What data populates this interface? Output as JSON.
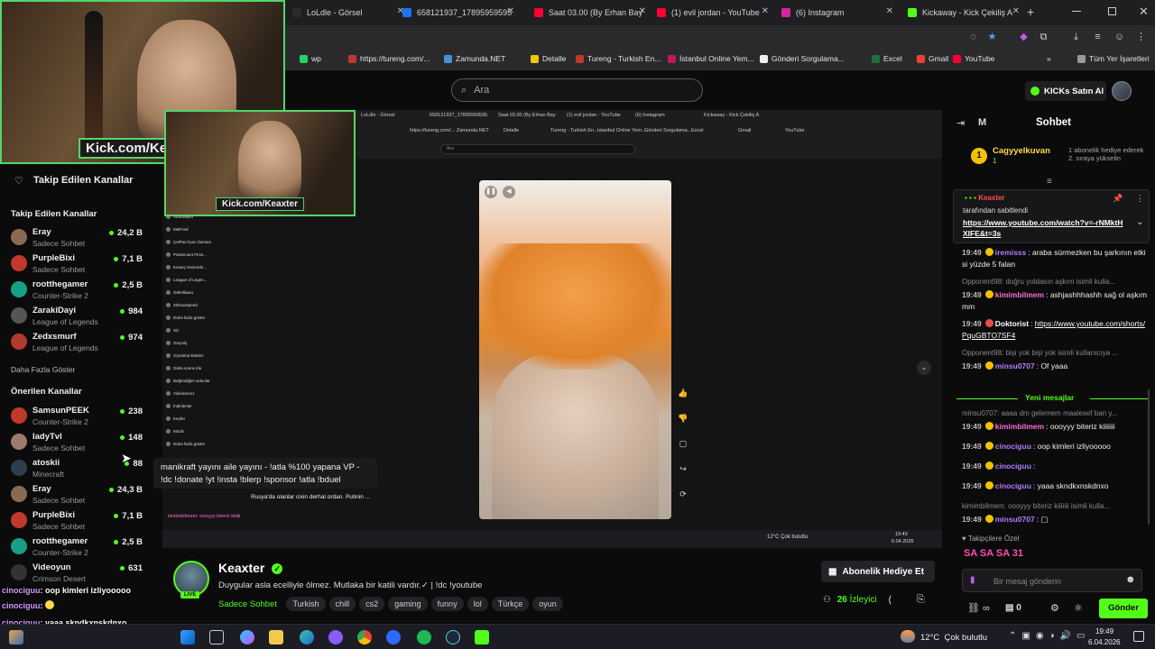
{
  "browser": {
    "tabs": [
      {
        "label": "LoLdle - Görsel",
        "color": "#2b2b2b"
      },
      {
        "label": "658121937_17895959595",
        "color": "#1877f2"
      },
      {
        "label": "Saat 03.00 (By Erhan Bay",
        "color": "#ff0033"
      },
      {
        "label": "(1) evil jordan - YouTube",
        "color": "#ff0033"
      },
      {
        "label": "(6) Instagram",
        "color": "#d6249f"
      },
      {
        "label": "Kickaway - Kick Çekiliş A",
        "color": "#53fc18"
      }
    ],
    "new_tab": "+",
    "bookmarks": [
      {
        "label": "wp",
        "color": "#25d366"
      },
      {
        "label": "https://tureng.com/...",
        "color": "#c0392b"
      },
      {
        "label": "Zamunda.NET",
        "color": "#4a90d9"
      },
      {
        "label": "Detalle",
        "color": "#f1c40f"
      },
      {
        "label": "Tureng - Turkish En...",
        "color": "#c0392b"
      },
      {
        "label": "İstanbul Online Yem...",
        "color": "#c2185b"
      },
      {
        "label": "Gönderi Sorgulama...",
        "color": "#eeeeee"
      },
      {
        "label": "Excel",
        "color": "#1d6f42"
      },
      {
        "label": "Gmail",
        "color": "#ea4335"
      },
      {
        "label": "YouTube",
        "color": "#ff0033"
      }
    ],
    "all_bookmarks": "Tüm Yer İşaretleri"
  },
  "header": {
    "search_placeholder": "Ara",
    "buy_kicks": "KICKs Satın Al"
  },
  "webcam": {
    "tag": "Kick.com/Keaxter"
  },
  "sidebar": {
    "title": "Takip Edilen Kanallar",
    "followed_header": "Takip Edilen Kanallar",
    "followed": [
      {
        "name": "Eray",
        "game": "Sadece Sohbet",
        "viewers": "24,2 B",
        "color": "#8a6b52"
      },
      {
        "name": "PurpleBixi",
        "game": "Sadece Sohbet",
        "viewers": "7,1 B",
        "color": "#c0392b"
      },
      {
        "name": "rootthegamer",
        "game": "Counter-Strike 2",
        "viewers": "2,5 B",
        "color": "#16a085"
      },
      {
        "name": "ZarakiDayi",
        "game": "League of Legends",
        "viewers": "984",
        "color": "#555555"
      },
      {
        "name": "Zedxsmurf",
        "game": "League of Legends",
        "viewers": "974",
        "color": "#b03a2e"
      }
    ],
    "show_more": "Daha Fazla Göster",
    "recommended_header": "Önerilen Kanallar",
    "recommended": [
      {
        "name": "SamsunPEEK",
        "game": "Counter-Strike 2",
        "viewers": "238",
        "color": "#c0392b"
      },
      {
        "name": "ladyTvl",
        "game": "Sadece Sohbet",
        "viewers": "148",
        "color": "#9b7b6b"
      },
      {
        "name": "atoskii",
        "game": "Minecraft",
        "viewers": "88",
        "color": "#2c3e50"
      },
      {
        "name": "Eray",
        "game": "Sadece Sohbet",
        "viewers": "24,3 B",
        "color": "#8a6b52"
      },
      {
        "name": "PurpleBixi",
        "game": "Sadece Sohbet",
        "viewers": "7,1 B",
        "color": "#c0392b"
      },
      {
        "name": "rootthegamer",
        "game": "Counter-Strike 2",
        "viewers": "2,5 B",
        "color": "#16a085"
      },
      {
        "name": "Videoyun",
        "game": "Crimson Desert",
        "viewers": "631",
        "color": "#333333"
      }
    ]
  },
  "tooltip": {
    "line1": "manikraft yayını aile yayını - !atla %100 yapana VP -",
    "line2": "!dc !donate !yt !insta !blerp !sponsor !atla !bduel"
  },
  "overlay_chat": [
    {
      "user": "cinociguu",
      "text": "oop kimleri izliyooooo"
    },
    {
      "user": "cinociguu",
      "text": ""
    },
    {
      "user": "cinociguu",
      "text": "yaaa skndkxnskdnxo"
    }
  ],
  "stream": {
    "live": "LIVE",
    "channel": "Keaxter",
    "title": "Duygular asla ecelliyle ölmez. Mutlaka bir katili vardır.✓ | !dc !youtube",
    "category": "Sadece Sohbet",
    "tags": [
      "Turkish",
      "chill",
      "cs2",
      "gaming",
      "funny",
      "lol",
      "Türkçe",
      "oyun"
    ],
    "sub_gift": "Abonelik Hediye Et",
    "viewers_count": "26",
    "viewers_label": "İzleyici"
  },
  "chat": {
    "title": "Sohbet",
    "side_letter": "M",
    "gifter": {
      "name": "Cagyyelkuvan",
      "count": "1",
      "note": "1 abonelik hediye ederek 2. sıraya yükselin"
    },
    "pinned": {
      "by": "Keaxter",
      "label": "tarafından sabitlendi",
      "url": "https://www.youtube.com/watch?v=-rNMktHXIFE&t=3s"
    },
    "messages_before": [
      {
        "time": "19:49",
        "user": "iremisss",
        "color": "#b47cff",
        "text": "araba sürmezken bu şarkının etkisi yüzde 5 falan"
      },
      {
        "system": "Opponent98: doğru yoldasın aşkım isimli kulla..."
      },
      {
        "time": "19:49",
        "user": "kimimbilmem",
        "color": "#ff6bd6",
        "text": "ashjashhhashh sağ ol aşkımmm"
      },
      {
        "time": "19:49",
        "user": "Doktorist",
        "color": "#ffffff",
        "text": "https://www.youtube.com/shorts/PquGBTO7SF4"
      },
      {
        "system": "Opponent98: bişi yok bişi yok isimli kullanıcıya ..."
      },
      {
        "time": "19:49",
        "user": "minsu0707",
        "color": "#b47cff",
        "text": "Of yaaa"
      }
    ],
    "new_messages": "Yeni mesajlar",
    "messages_after": [
      {
        "system": "minsu0707: aaaa dm gelemem maalesef ban y..."
      },
      {
        "time": "19:49",
        "user": "kimimbilmem",
        "color": "#ff6bd6",
        "text": "oooyyy biteriz kiiiiiii"
      },
      {
        "time": "19:49",
        "user": "cinociguu",
        "color": "#b47cff",
        "text": "oop kimleri izliyooooo"
      },
      {
        "time": "19:49",
        "user": "cinociguu",
        "color": "#b47cff",
        "text": ""
      },
      {
        "time": "19:49",
        "user": "cinociguu",
        "color": "#b47cff",
        "text": "yaaa skndkxnskdnxo"
      },
      {
        "system": "kimimbilmem: oooyyy biteriz kiiiiiii isimli kulla..."
      },
      {
        "time": "19:49",
        "user": "minsu0707",
        "color": "#b47cff",
        "text": "▢"
      }
    ],
    "special_label": "Takipçilere Özel",
    "special_emotes": "SA SA SA 31",
    "input_placeholder": "Bir mesaj gönderin",
    "points": "0",
    "send": "Gönder",
    "infinity": "∞"
  },
  "nested": {
    "tabs": [
      "LoLdle - Görsel",
      "658121937_17895959595",
      "Saat 03.00 (By Erhan Bay",
      "(1) evil jordan - YouTube",
      "(6) Instagram",
      "Kickaway - Kick Çekiliş A"
    ],
    "bookmarks": [
      "https://tureng.com/...",
      "Zamunda.NET",
      "Detalle",
      "Tureng - Turkish En...",
      "İstanbul Online Yem...",
      "Gönderi Sorgulama...",
      "Excel",
      "Gmail",
      "YouTube"
    ],
    "yt_search": "Ara",
    "yt_left": [
      "Abonelikler",
      "MelFred",
      "ÇetPat Oyun Zamanı",
      "Paramount Picto...",
      "Kıvanç Hazırede...",
      "League of Legen...",
      "GMHlilianu",
      "3ShowSpeed",
      "Daha fazla göster",
      "Siz",
      "Geçmiş",
      "Oynatma listeleri",
      "Daha sonra izle",
      "Beğendiğim videolar",
      "Videolarınız",
      "İndirilenler",
      "Keşfet",
      "Müzik",
      "Daha fazla göster"
    ],
    "weather": "12°C Çok bulutlu",
    "time": "19:49",
    "date": "6.04.2026",
    "news": "Rusya'da olanlar cixin derhal ordan. Putinin ...",
    "chat_line": "kimimbilmem: oooyyy biteriz kiiiiii"
  },
  "taskbar": {
    "weather": "12°C  Çok bulutlu",
    "time": "19:49",
    "date": "6.04.2026"
  }
}
